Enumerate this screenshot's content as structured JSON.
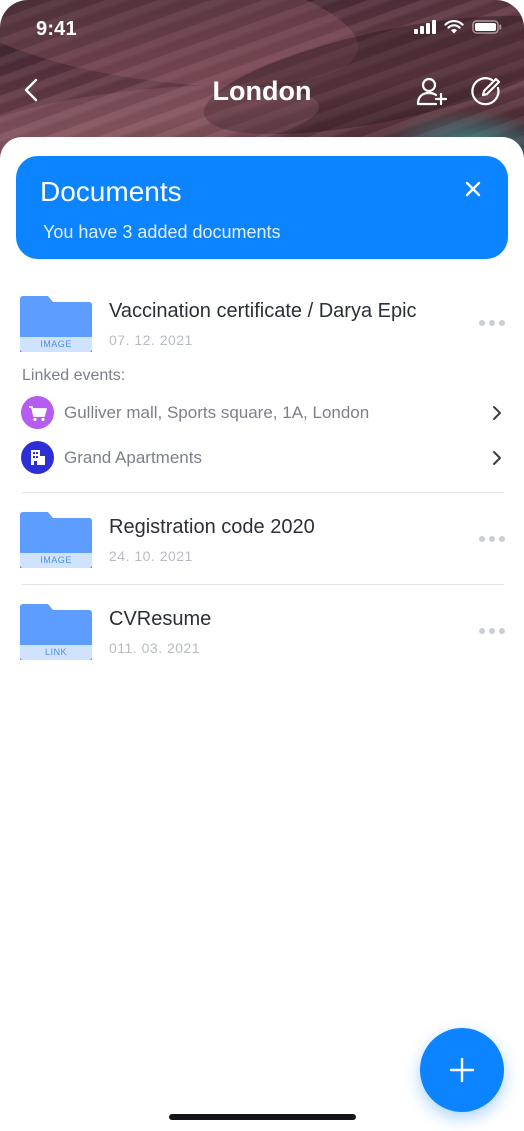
{
  "status_bar": {
    "time": "9:41",
    "icons": [
      "signal-icon",
      "wifi-icon",
      "battery-icon"
    ]
  },
  "nav": {
    "title": "London",
    "back_icon": "chevron-left-icon",
    "add_user_icon": "add-user-icon",
    "edit_icon": "edit-icon"
  },
  "banner": {
    "title": "Documents",
    "subtitle": "You have 3 added documents",
    "close_icon": "close-icon"
  },
  "documents": [
    {
      "title": "Vaccination certificate / Darya Epic",
      "date": "07. 12. 2021",
      "type": "IMAGE"
    },
    {
      "title": "Registration code 2020",
      "date": "24. 10. 2021",
      "type": "IMAGE"
    },
    {
      "title": "CVResume",
      "date": "011. 03. 2021",
      "type": "LINK"
    }
  ],
  "linked": {
    "label": "Linked events:",
    "events": [
      {
        "text": "Gulliver mall, Sports square, 1A, London",
        "icon": "shopping-cart-icon",
        "color": "#b65cf0"
      },
      {
        "text": "Grand Apartments",
        "icon": "building-icon",
        "color": "#2c2fd6"
      }
    ]
  },
  "fab": {
    "icon": "plus-icon"
  },
  "colors": {
    "accent": "#0d84ff",
    "folder": "#5c9dff",
    "folder_tag": "#cfe3ff"
  }
}
